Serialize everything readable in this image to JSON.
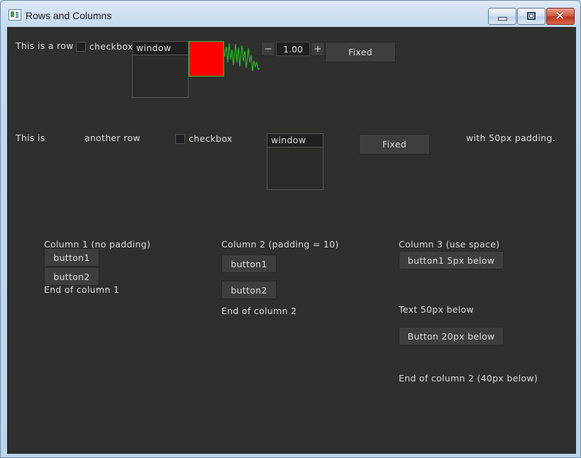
{
  "window": {
    "title": "Rows and Columns",
    "icon": "app-window-icon",
    "controls": {
      "minimize": "minimize-icon",
      "maximize": "maximize-icon",
      "close": "✕"
    }
  },
  "row1": {
    "label": "This is a row",
    "checkbox_label": "checkbox",
    "window_title": "window",
    "spinner_minus": "−",
    "spinner_value": "1.00",
    "spinner_plus": "+",
    "fixed_button": "Fixed",
    "color_box": "#ff0000",
    "wave_color": "#1fd11f"
  },
  "row2": {
    "label1": "This is",
    "label2": "another row",
    "checkbox_label": "checkbox",
    "window_title": "window",
    "fixed_button": "Fixed",
    "label3": "with 50px padding."
  },
  "col1": {
    "title": "Column 1 (no padding)",
    "button1": "button1",
    "button2": "button2",
    "end": "End of column 1"
  },
  "col2": {
    "title": "Column 2 (padding = 10)",
    "button1": "button1",
    "button2": "button2",
    "end": "End of column 2"
  },
  "col3": {
    "title": "Column 3 (use space)",
    "button1": "button1 5px below",
    "text": "Text 50px below",
    "button2": "Button 20px below",
    "end": "End of column 2 (40px below)"
  }
}
